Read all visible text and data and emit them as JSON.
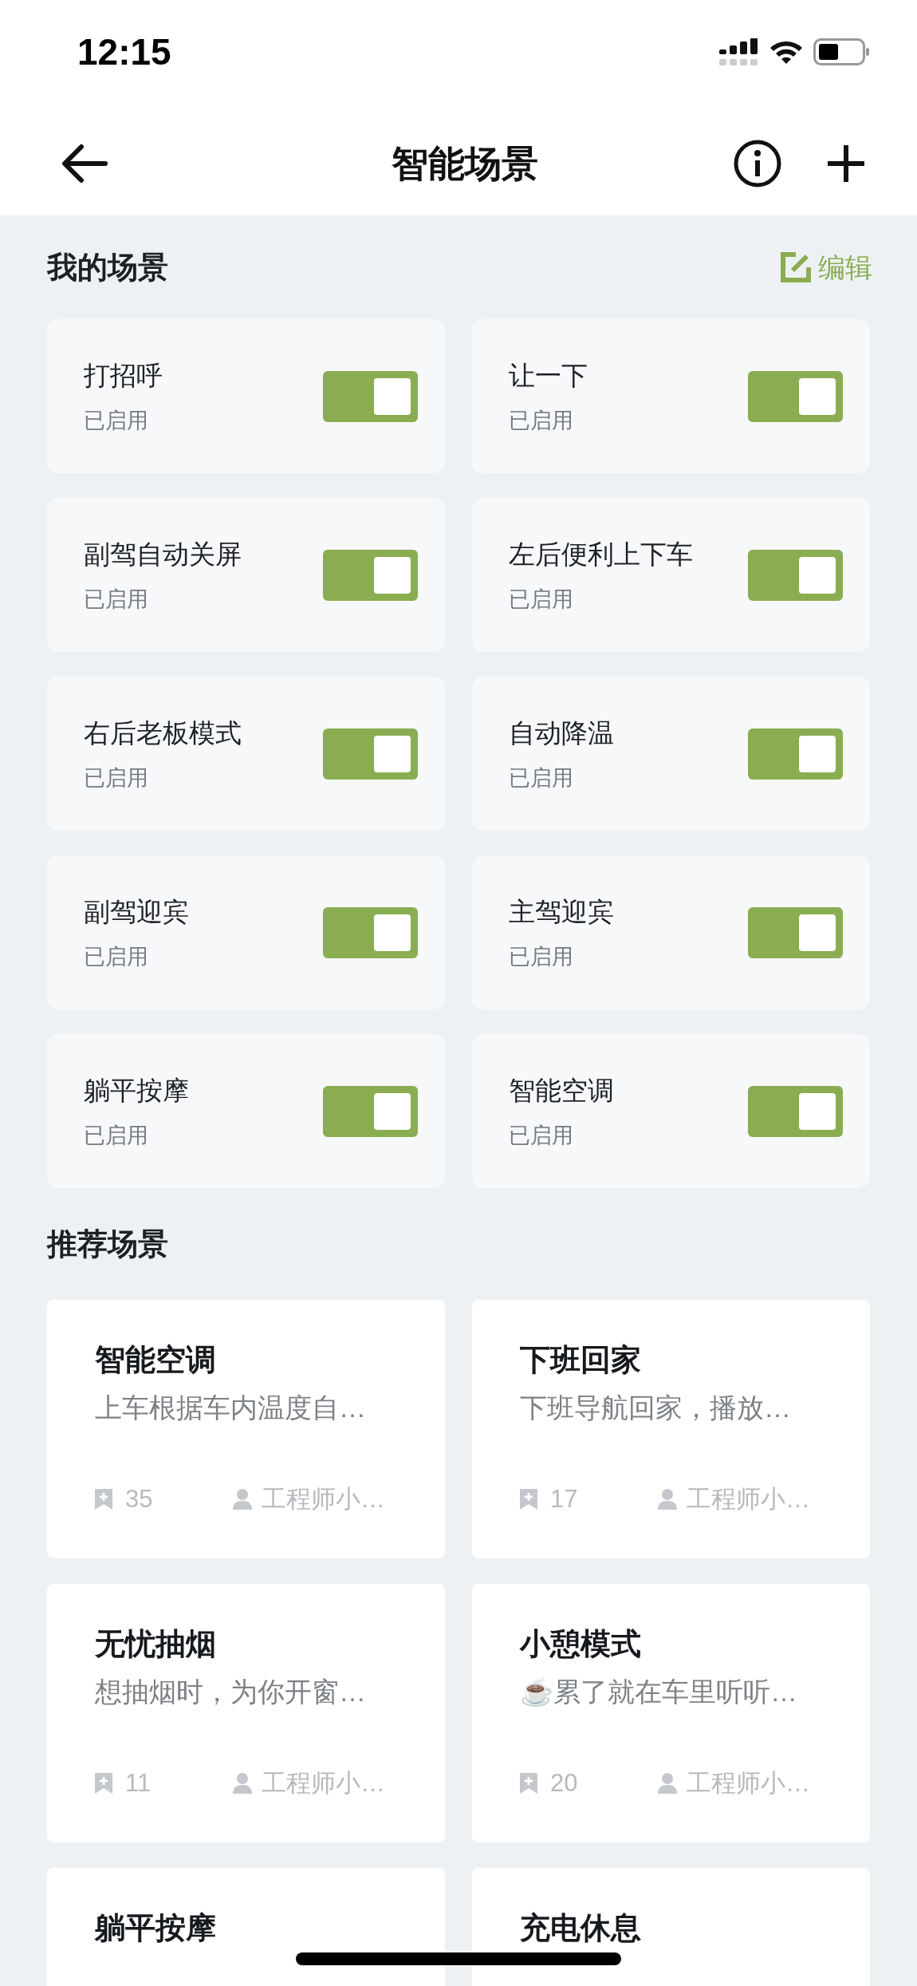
{
  "status_bar": {
    "time": "12:15"
  },
  "header": {
    "title": "智能场景"
  },
  "my_scenes": {
    "title": "我的场景",
    "edit_label": "编辑",
    "items": [
      {
        "name": "打招呼",
        "status": "已启用",
        "on": true
      },
      {
        "name": "让一下",
        "status": "已启用",
        "on": true
      },
      {
        "name": "副驾自动关屏",
        "status": "已启用",
        "on": true
      },
      {
        "name": "左后便利上下车",
        "status": "已启用",
        "on": true
      },
      {
        "name": "右后老板模式",
        "status": "已启用",
        "on": true
      },
      {
        "name": "自动降温",
        "status": "已启用",
        "on": true
      },
      {
        "name": "副驾迎宾",
        "status": "已启用",
        "on": true
      },
      {
        "name": "主驾迎宾",
        "status": "已启用",
        "on": true
      },
      {
        "name": "躺平按摩",
        "status": "已启用",
        "on": true
      },
      {
        "name": "智能空调",
        "status": "已启用",
        "on": true
      }
    ]
  },
  "recommended": {
    "title": "推荐场景",
    "items": [
      {
        "title": "智能空调",
        "description": "上车根据车内温度自…",
        "saves": "35",
        "author": "工程师小…"
      },
      {
        "title": "下班回家",
        "description": "下班导航回家，播放…",
        "saves": "17",
        "author": "工程师小…"
      },
      {
        "title": "无忧抽烟",
        "description": "想抽烟时，为你开窗…",
        "saves": "11",
        "author": "工程师小…"
      },
      {
        "title": "小憩模式",
        "description": "☕累了就在车里听听…",
        "saves": "20",
        "author": "工程师小…"
      },
      {
        "title": "躺平按摩"
      },
      {
        "title": "充电休息"
      }
    ]
  }
}
